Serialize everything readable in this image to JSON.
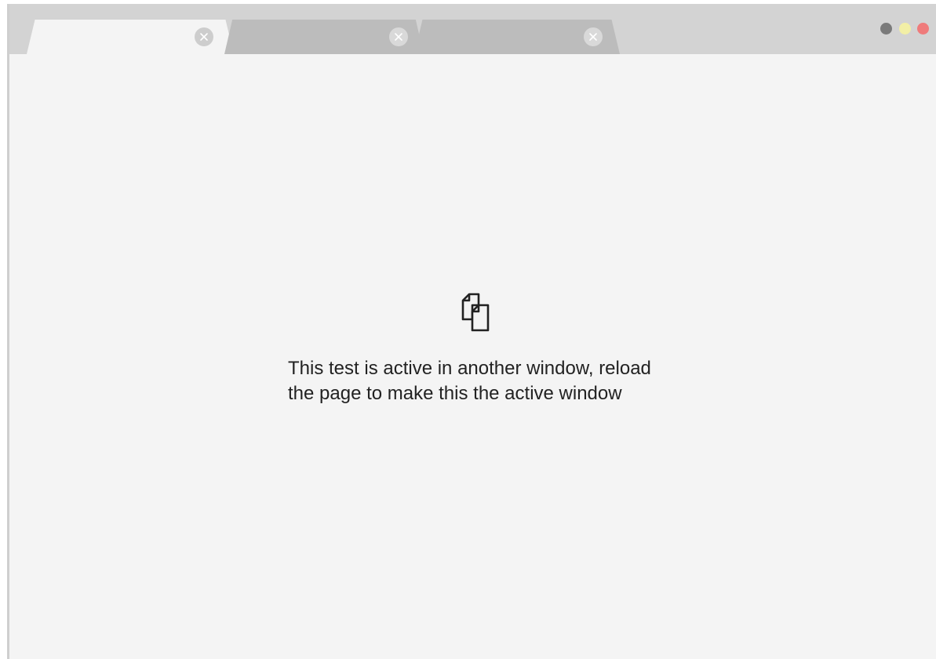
{
  "browser": {
    "tabs": [
      {
        "active": true
      },
      {
        "active": false
      },
      {
        "active": false
      }
    ],
    "window_controls": {
      "grey_color": "#7a7a7a",
      "yellow_color": "#f2efa6",
      "red_color": "#ef7b7b"
    }
  },
  "main": {
    "icon": "duplicate-documents-icon",
    "message": "This test is active in another window, reload the page to make this the active window"
  },
  "colors": {
    "tabbar": "#d3d3d3",
    "active_tab": "#f4f4f4",
    "inactive_tab": "#bcbcbc",
    "page_background": "#f4f4f4",
    "text": "#222222"
  }
}
